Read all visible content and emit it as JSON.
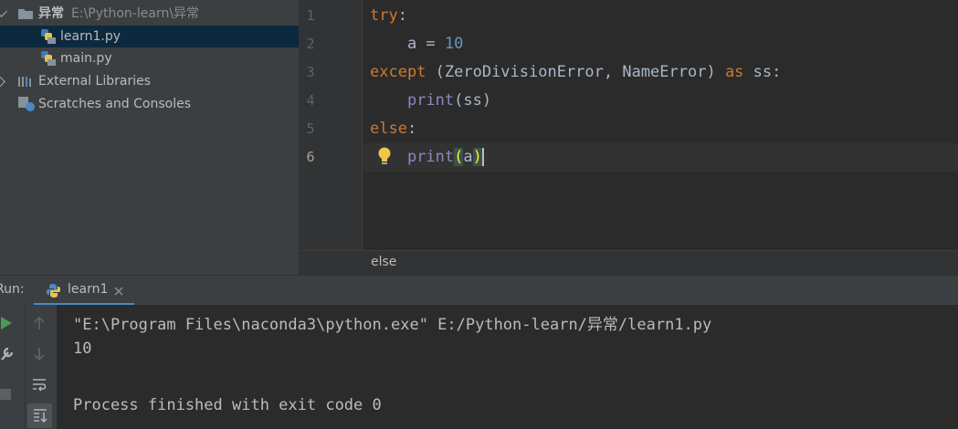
{
  "project": {
    "root_folder_name": "异常",
    "root_folder_path": "E:\\Python-learn\\异常",
    "files": [
      "learn1.py",
      "main.py"
    ],
    "external_libraries": "External Libraries",
    "scratches": "Scratches and Consoles"
  },
  "editor": {
    "line_numbers": [
      "1",
      "2",
      "3",
      "4",
      "5",
      "6"
    ],
    "code": {
      "l1_kw": "try",
      "l1_colon": ":",
      "l2_var": "a = ",
      "l2_num": "10",
      "l3_kw": "except",
      "l3_rest": " (ZeroDivisionError, NameError) ",
      "l3_as": "as",
      "l3_tail": " ss:",
      "l4_fn": "print",
      "l4_args": "(ss)",
      "l5_kw": "else",
      "l5_colon": ":",
      "l6_fn": "print",
      "l6_open": "(",
      "l6_arg": "a",
      "l6_close": ")"
    },
    "breadcrumb": "else"
  },
  "run": {
    "label": "Run:",
    "tab_name": "learn1",
    "output": [
      "\"E:\\Program Files\\naconda3\\python.exe\" E:/Python-learn/异常/learn1.py",
      "10",
      "",
      "Process finished with exit code 0"
    ]
  },
  "colors": {
    "keyword": "#cc7832",
    "number": "#6897bb",
    "builtin": "#8888c6",
    "selection": "#0d293e",
    "run_green": "#499c54"
  },
  "icons": [
    "folder-icon",
    "python-file-icon",
    "library-icon",
    "scratches-icon",
    "lightbulb-icon",
    "python-logo-icon",
    "close-icon",
    "run-icon",
    "wrench-icon",
    "stop-icon",
    "up-arrow-icon",
    "down-arrow-icon",
    "soft-wrap-icon",
    "scroll-to-end-icon",
    "chevron-down-icon",
    "chevron-right-icon"
  ]
}
